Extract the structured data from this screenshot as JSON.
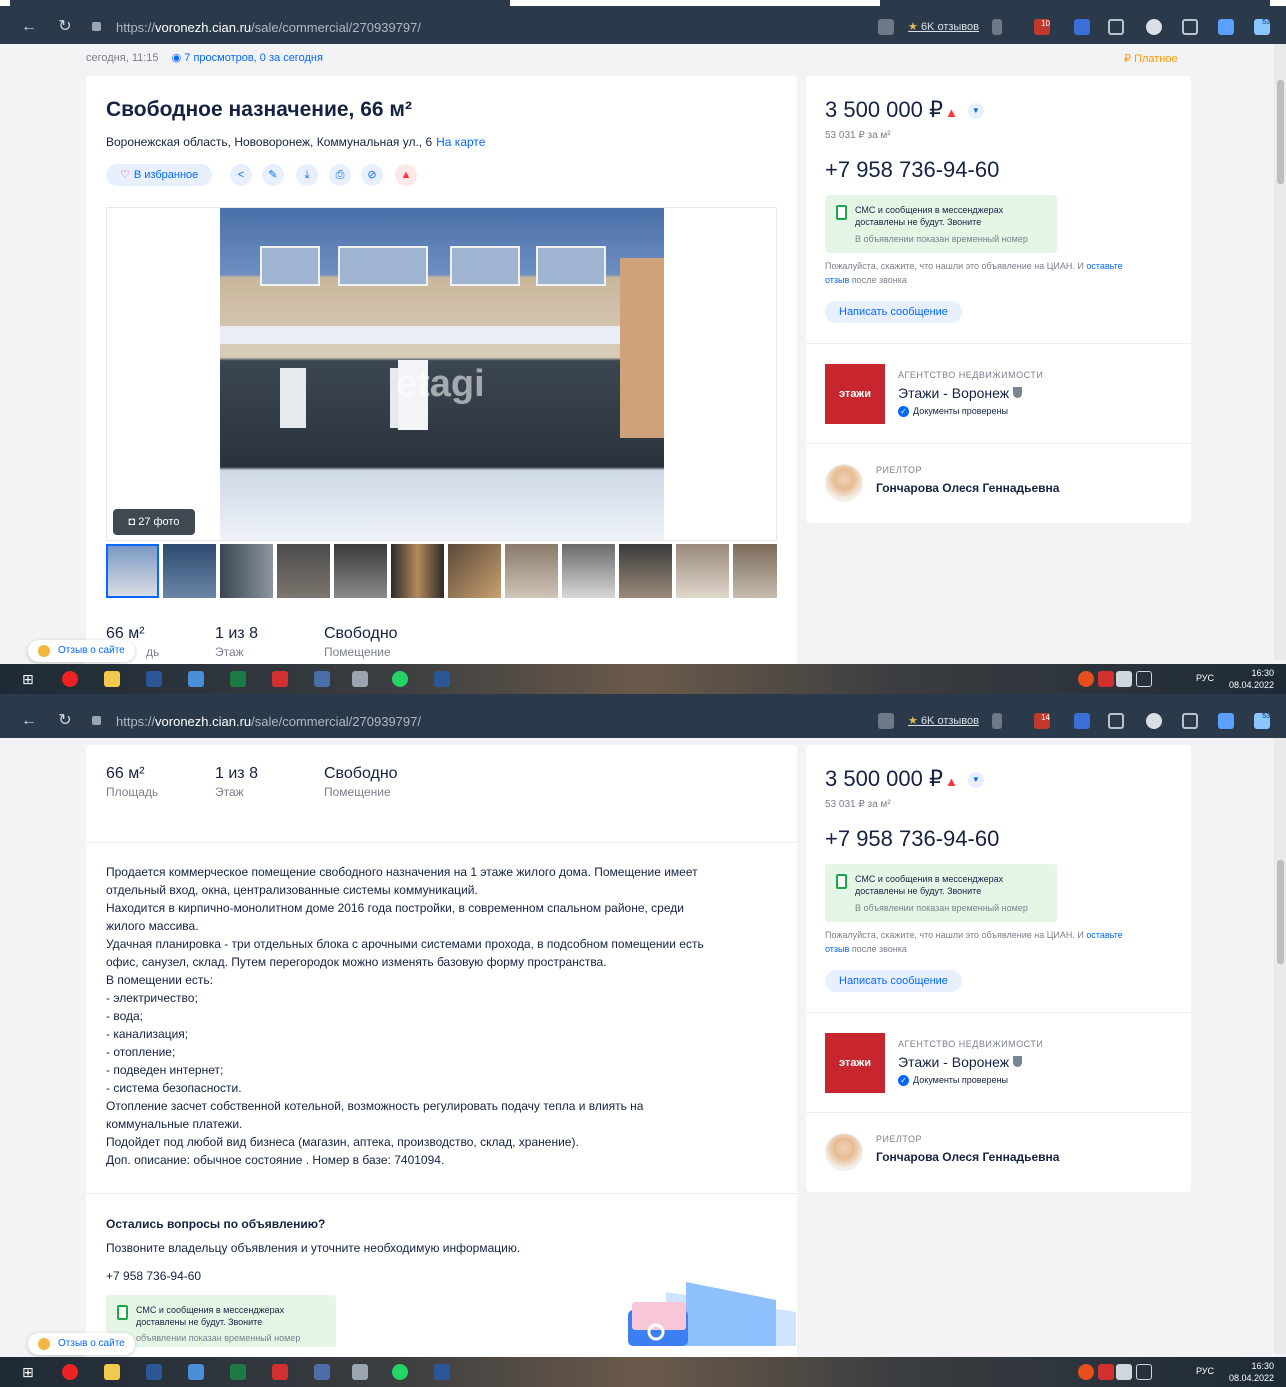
{
  "browser": {
    "url_prefix": "https://",
    "url_domain": "voronezh.cian.ru",
    "url_path": "/sale/commercial/270939797/",
    "reviews_star": "★",
    "reviews_label": "6K отзывов",
    "badge1_shot1": "10",
    "badge1_shot2": "14",
    "badge2": "53"
  },
  "listing": {
    "posted": "сегодня, 11:15",
    "views": "7 просмотров, 0 за сегодня",
    "paid_icon": "₽",
    "paid_label": "Платное",
    "title": "Свободное назначение, 66 м²",
    "address": "Воронежская область, Нововоронеж, Коммунальная ул., 6",
    "map_link": "На карте",
    "favorite_label": "В избранное",
    "photo_count": "27 фото",
    "photo_logo": "etagi",
    "stats": [
      {
        "value": "66 м²",
        "label": "Площадь"
      },
      {
        "value": "1 из 8",
        "label": "Этаж"
      },
      {
        "value": "Свободно",
        "label": "Помещение"
      }
    ],
    "stats_shot1_area_label": "дь",
    "description": "Продается коммерческое помещение свободного назначения на 1 этаже жилого дома. Помещение имеет\nотдельный вход, окна, централизованные системы коммуникаций.\nНаходится в кирпично-монолитном доме 2016 года постройки, в современном спальном районе, среди\nжилого массива.\nУдачная планировка - три отдельных блока с арочными системами прохода, в подсобном помещении есть\nофис, санузел, склад. Путем перегородок можно изменять базовую форму пространства.\nВ помещении есть:\n- электричество;\n- вода;\n- канализация;\n- отопление;\n- подведен интернет;\n- система безопасности.\nОтопление засчет собственной котельной, возможность регулировать подачу тепла и влиять на\nкоммунальные платежи.\nПодойдет под любой вид бизнеса (магазин, аптека, производство, склад, хранение).\n Доп. описание: обычное состояние . Номер в базе: 7401094.",
    "questions_title": "Остались вопросы по объявлению?",
    "questions_text": "Позвоните владельцу объявления и уточните необходимую информацию.",
    "questions_phone": "+7 958 736-94-60",
    "questions_sms_line1": "СМС и сообщения в мессенджерах",
    "questions_sms_line2": "доставлены не будут. Звоните",
    "questions_sms_note": "объявлении показан временный номер"
  },
  "sidebar": {
    "price": "3 500 000 ₽",
    "price_arrow": "▲",
    "price_per_m": "53 031 ₽ за м²",
    "phone": "+7 958 736-94-60",
    "sms_line1": "СМС и сообщения в мессенджерах",
    "sms_line2": "доставлены не будут. Звоните",
    "sms_note": "В объявлении показан временный номер",
    "please_text": "Пожалуйста, скажите, что нашли это объявление на ЦИАН. И ",
    "please_link1": "оставьте",
    "please_link2": "отзыв",
    "please_tail": " после звонка",
    "write_button": "Написать сообщение",
    "agency_logo": "этажи",
    "agency_type": "АГЕНТСТВО НЕДВИЖИМОСТИ",
    "agency_name": "Этажи - Воронеж",
    "agency_verified": "Документы проверены",
    "realtor_type": "РИЕЛТОР",
    "realtor_name": "Гончарова Олеся Геннадьевна"
  },
  "feedback_label": "Отзыв о сайте",
  "taskbar": {
    "time": "16:30",
    "date": "08.04.2022",
    "lang": "РУС"
  },
  "colors": {
    "accent": "#0468ff",
    "brand_red": "#c8262e",
    "text": "#152242",
    "muted": "#7a7f8a"
  }
}
